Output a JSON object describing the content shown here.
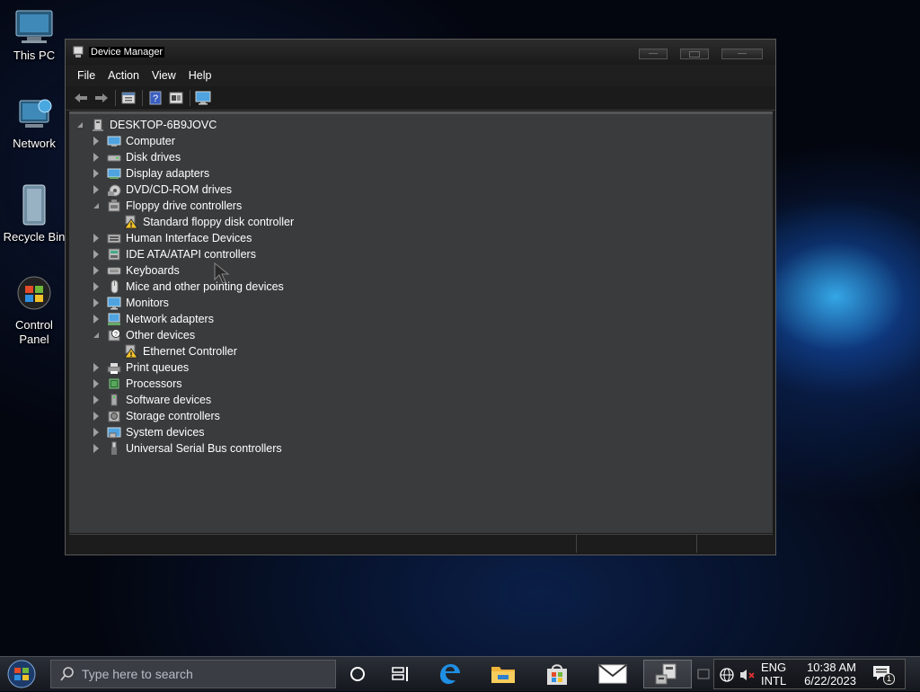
{
  "desktop": {
    "icons": [
      {
        "label": "This PC"
      },
      {
        "label": "Network"
      },
      {
        "label": "Recycle Bin"
      },
      {
        "label": "Control Panel"
      }
    ]
  },
  "window": {
    "title": "Device Manager",
    "menu": [
      "File",
      "Action",
      "View",
      "Help"
    ],
    "toolbar_icons": [
      "back-arrow-icon",
      "forward-arrow-icon",
      "properties-icon",
      "help-icon",
      "view-icon",
      "monitor-icon"
    ]
  },
  "tree": {
    "root": "DESKTOP-6B9JOVC",
    "items": [
      {
        "label": "Computer",
        "icon": "computer-icon",
        "expanded": false
      },
      {
        "label": "Disk drives",
        "icon": "disk-drive-icon",
        "expanded": false
      },
      {
        "label": "Display adapters",
        "icon": "display-adapter-icon",
        "expanded": false
      },
      {
        "label": "DVD/CD-ROM drives",
        "icon": "dvd-drive-icon",
        "expanded": false
      },
      {
        "label": "Floppy drive controllers",
        "icon": "floppy-controller-icon",
        "expanded": true
      },
      {
        "label": "Standard floppy disk controller",
        "icon": "warning-device-icon",
        "child": true
      },
      {
        "label": "Human Interface Devices",
        "icon": "hid-icon",
        "expanded": false
      },
      {
        "label": "IDE ATA/ATAPI controllers",
        "icon": "ide-controller-icon",
        "expanded": false
      },
      {
        "label": "Keyboards",
        "icon": "keyboard-icon",
        "expanded": false
      },
      {
        "label": "Mice and other pointing devices",
        "icon": "mouse-icon",
        "expanded": false
      },
      {
        "label": "Monitors",
        "icon": "monitor-icon",
        "expanded": false
      },
      {
        "label": "Network adapters",
        "icon": "network-adapter-icon",
        "expanded": false
      },
      {
        "label": "Other devices",
        "icon": "unknown-device-icon",
        "expanded": true
      },
      {
        "label": "Ethernet Controller",
        "icon": "warning-device-icon",
        "child": true
      },
      {
        "label": "Print queues",
        "icon": "printer-icon",
        "expanded": false
      },
      {
        "label": "Processors",
        "icon": "processor-icon",
        "expanded": false
      },
      {
        "label": "Software devices",
        "icon": "software-device-icon",
        "expanded": false
      },
      {
        "label": "Storage controllers",
        "icon": "storage-controller-icon",
        "expanded": false
      },
      {
        "label": "System devices",
        "icon": "system-device-icon",
        "expanded": false
      },
      {
        "label": "Universal Serial Bus controllers",
        "icon": "usb-icon",
        "expanded": false
      }
    ]
  },
  "taskbar": {
    "search_placeholder": "Type here to search",
    "lang_line1": "ENG",
    "lang_line2": "INTL",
    "time": "10:38 AM",
    "date": "6/22/2023",
    "notification_count": "1"
  }
}
